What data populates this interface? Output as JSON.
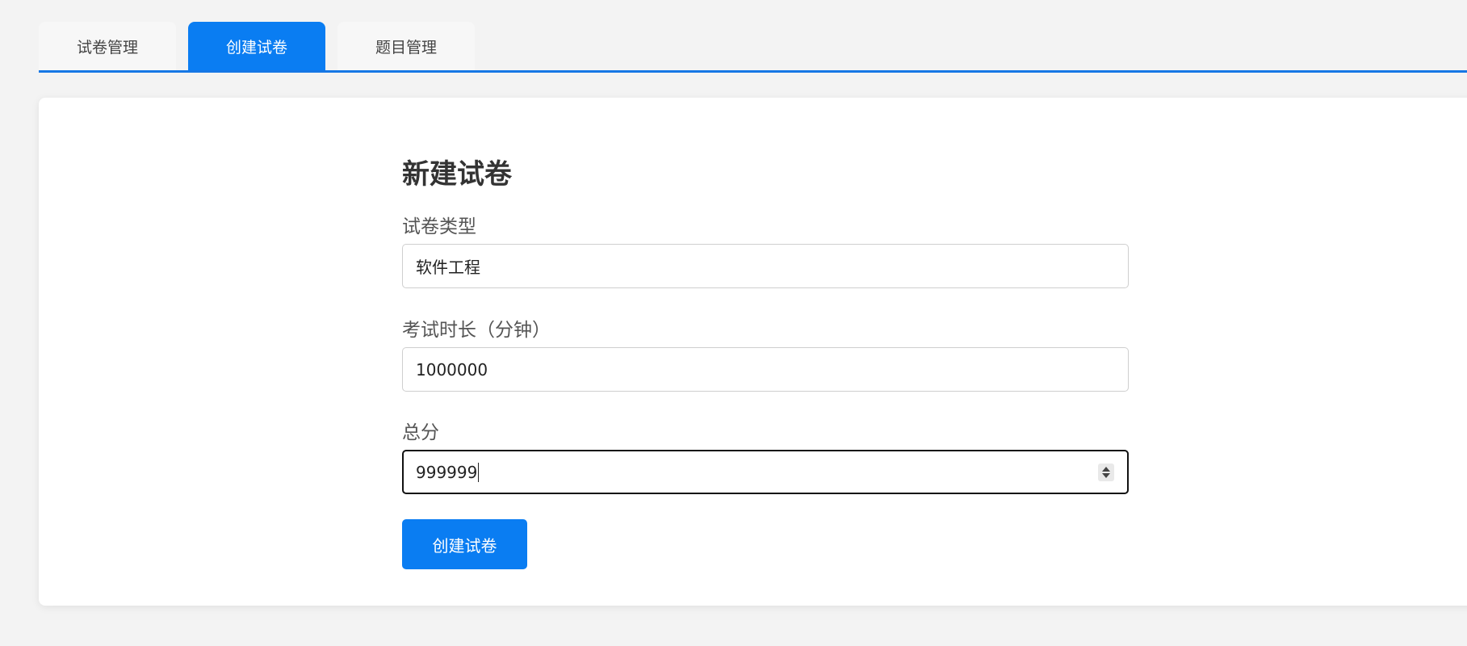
{
  "tabs": [
    {
      "label": "试卷管理",
      "active": false
    },
    {
      "label": "创建试卷",
      "active": true
    },
    {
      "label": "题目管理",
      "active": false
    }
  ],
  "form": {
    "title": "新建试卷",
    "fields": [
      {
        "label": "试卷类型",
        "value": "软件工程"
      },
      {
        "label": "考试时长（分钟）",
        "value": "1000000"
      },
      {
        "label": "总分",
        "value": "999999",
        "focused": true
      }
    ],
    "submit_label": "创建试卷"
  },
  "colors": {
    "accent": "#0a7df2",
    "tab_underline": "#1677e5",
    "background": "#f3f3f3"
  }
}
